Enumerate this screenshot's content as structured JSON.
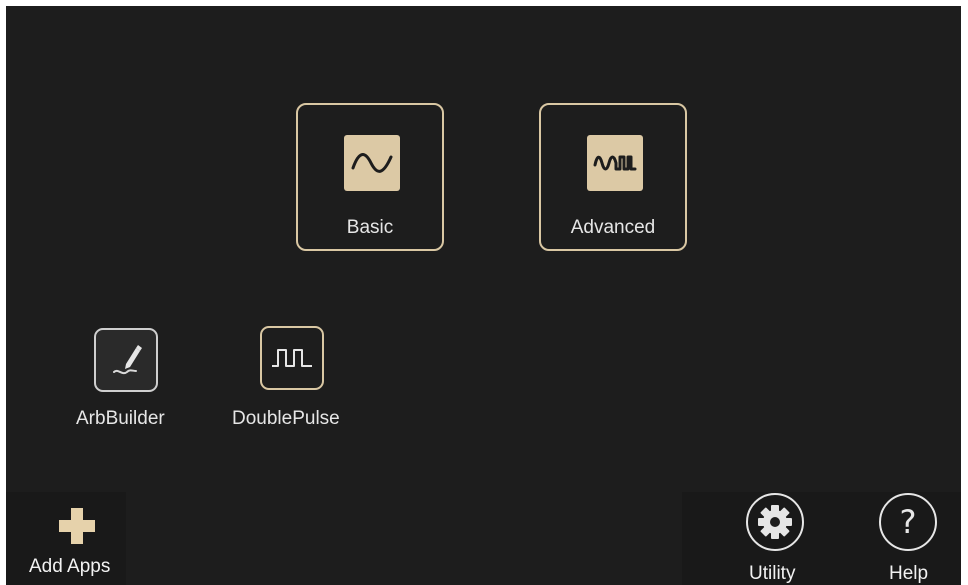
{
  "modes": {
    "basic": {
      "label": "Basic",
      "icon": "sine-wave-icon"
    },
    "advanced": {
      "label": "Advanced",
      "icon": "complex-wave-icon"
    }
  },
  "apps": [
    {
      "label": "ArbBuilder",
      "icon": "pen-waveform-icon"
    },
    {
      "label": "DoublePulse",
      "icon": "double-pulse-icon"
    }
  ],
  "bottom_bar": {
    "add_apps": {
      "label": "Add Apps",
      "icon": "plus-icon"
    },
    "utility": {
      "label": "Utility",
      "icon": "gear-icon"
    },
    "help": {
      "label": "Help",
      "icon": "question-mark-icon"
    }
  },
  "colors": {
    "background": "#1d1d1d",
    "accent": "#dcc9a5",
    "tile_border": "#d9c7a3",
    "text": "#e6e6e6"
  }
}
